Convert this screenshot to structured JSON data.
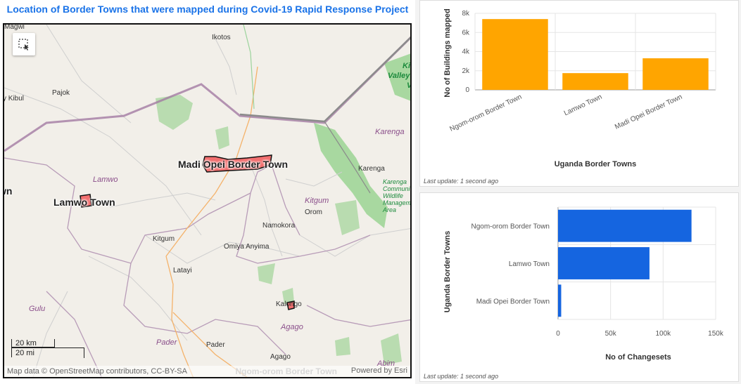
{
  "map": {
    "title": "Location of Border Towns that were mapped during Covid-19 Rapid Response Project",
    "select_tool_icon": "rectangle-select-icon",
    "places": {
      "magwi": "Magwi",
      "ikotos": "Ikotos",
      "pajok": "Pajok",
      "kibul": "y Kibul",
      "kidepo": "Kid",
      "valley": "Valley",
      "ve": "V",
      "karenga_district": "Karenga",
      "madi_opei": "Madi Opei Border Town",
      "karenga_town": "Karenga",
      "lamwo_district": "Lamwo",
      "wn": "wn",
      "lamwo_town": "Lamwo Town",
      "kitgum_district": "Kitgum",
      "karenga_cwma": "Karenga\nCommunity\nWildlife\nManagement\nArea",
      "orom": "Orom",
      "namokora": "Namokora",
      "kitgum_town": "Kitgum",
      "omiya_anyima": "Omiya Anyima",
      "latayi": "Latayi",
      "gulu": "Gulu",
      "kalongo": "Kalongo",
      "agago_district": "Agago",
      "pader_district": "Pader",
      "pader_town": "Pader",
      "agago_town": "Agago",
      "abim": "Abim"
    },
    "scale": {
      "km": "20 km",
      "mi": "20 mi"
    },
    "attribution_left": "Map data © OpenStreetMap contributors, CC-BY-SA",
    "attribution_ghost": "Ngom-orom Border Town",
    "attribution_right": "Powered by Esri",
    "colors": {
      "town_fill": "#f26f6f",
      "town_outline": "#111111",
      "park_green": "#a8d8a0",
      "border": "#a27aa2",
      "intl_border": "#8b8b8b",
      "road": "#f4a460"
    }
  },
  "chart1": {
    "footnote": "Last update: 1 second ago",
    "chart_data": {
      "type": "bar",
      "categories": [
        "Ngom-orom Border Town",
        "Lamwo Town",
        "Madi Opei Border Town"
      ],
      "values": [
        7400,
        1750,
        3300
      ],
      "xlabel": "Uganda Border Towns",
      "ylabel": "No of Buildings mapped",
      "ylim": [
        0,
        8000
      ],
      "yticks": [
        "0",
        "2k",
        "4k",
        "6k",
        "8k"
      ],
      "color": "#ffa500",
      "grid": true
    }
  },
  "chart2": {
    "footnote": "Last update: 1 second ago",
    "chart_data": {
      "type": "bar",
      "orientation": "horizontal",
      "categories": [
        "Ngom-orom Border Town",
        "Lamwo Town",
        "Madi Opei Border Town"
      ],
      "values": [
        127000,
        87000,
        3000
      ],
      "xlabel": "No of Changesets",
      "ylabel": "Uganda Border Towns",
      "xlim": [
        0,
        150000
      ],
      "xticks": [
        "0",
        "50k",
        "100k",
        "150k"
      ],
      "color": "#1565e0",
      "grid": true
    }
  }
}
